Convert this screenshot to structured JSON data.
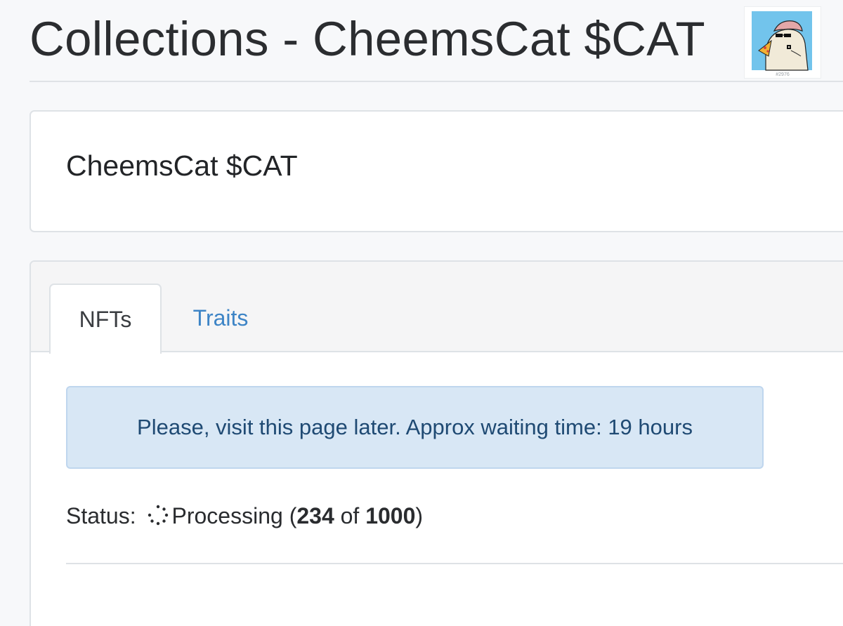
{
  "header": {
    "title": "Collections - CheemsCat $CAT",
    "avatar_caption": "#2976"
  },
  "collection": {
    "name": "CheemsCat $CAT"
  },
  "tabs": [
    {
      "label": "NFTs",
      "active": true
    },
    {
      "label": "Traits",
      "active": false
    }
  ],
  "alert": {
    "message": "Please, visit this page later. Approx waiting time: 19 hours"
  },
  "status": {
    "label": "Status:",
    "state": "Processing",
    "processed": "234",
    "of_word": "of",
    "total": "1000",
    "progress": 0.234,
    "icon": "spinner-icon"
  },
  "colors": {
    "tab_link": "#3d84c6",
    "alert_bg": "#d8e7f5",
    "alert_text": "#1f4a73"
  }
}
